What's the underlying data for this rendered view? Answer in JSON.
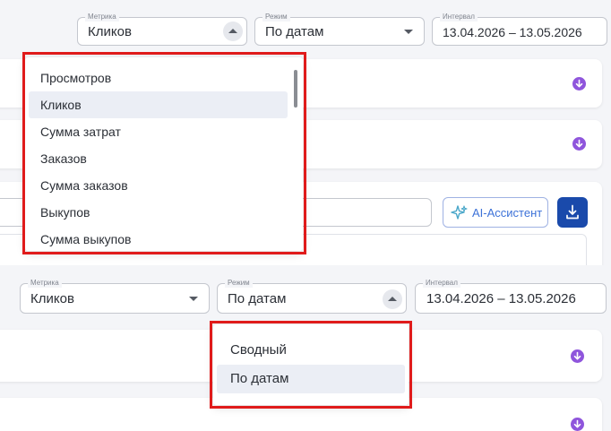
{
  "top": {
    "metric": {
      "legend": "Метрика",
      "value": "Кликов"
    },
    "mode": {
      "legend": "Режим",
      "value": "По датам"
    },
    "interval": {
      "legend": "Интервал",
      "value": "13.04.2026 – 13.05.2026"
    },
    "metric_options": [
      {
        "label": "Просмотров",
        "selected": false
      },
      {
        "label": "Кликов",
        "selected": true
      },
      {
        "label": "Сумма затрат",
        "selected": false
      },
      {
        "label": "Заказов",
        "selected": false
      },
      {
        "label": "Сумма заказов",
        "selected": false
      },
      {
        "label": "Выкупов",
        "selected": false
      },
      {
        "label": "Сумма выкупов",
        "selected": false
      }
    ],
    "ai_button": "AI-Ассистент"
  },
  "bottom": {
    "metric": {
      "legend": "Метрика",
      "value": "Кликов"
    },
    "mode": {
      "legend": "Режим",
      "value": "По датам"
    },
    "interval": {
      "legend": "Интервал",
      "value": "13.04.2026 – 13.05.2026"
    },
    "mode_options": [
      {
        "label": "Сводный",
        "selected": false
      },
      {
        "label": "По датам",
        "selected": true
      }
    ]
  },
  "colors": {
    "accent_purple": "#8f55dc",
    "highlight_red": "#e01b1b",
    "download_blue": "#1a4aab",
    "ai_blue": "#3d72d8"
  }
}
